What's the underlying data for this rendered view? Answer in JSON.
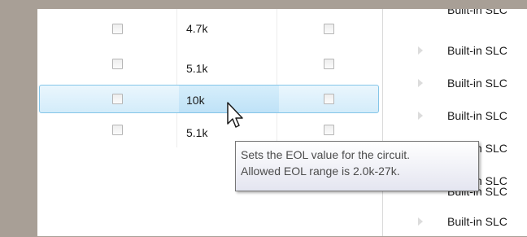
{
  "grid": {
    "rows": [
      {
        "enabled_checked": false,
        "eol": "4.7k",
        "alarm_checked": false,
        "selected": false
      },
      {
        "enabled_checked": false,
        "eol": "5.1k",
        "alarm_checked": false,
        "selected": false
      },
      {
        "enabled_checked": false,
        "eol": "10k",
        "alarm_checked": false,
        "selected": true
      },
      {
        "enabled_checked": false,
        "eol": "5.1k",
        "alarm_checked": false,
        "selected": false
      }
    ]
  },
  "tree": {
    "items": [
      {
        "label": "Built-in SLC"
      },
      {
        "label": "Built-in SLC"
      },
      {
        "label": "Built-in SLC"
      },
      {
        "label": "Built-in SLC"
      },
      {
        "label": "Built-in SLC"
      },
      {
        "label": "Built-in SLC"
      },
      {
        "label": "Built-in SLC"
      },
      {
        "label": "Built-in SLC"
      }
    ]
  },
  "tooltip": {
    "line1": "Sets the EOL value for the circuit.",
    "line2": "Allowed EOL range is 2.0k-27k."
  },
  "icons": {
    "cursor": "arrow-pointer-icon",
    "expander": "tree-expand-arrow-icon"
  },
  "colors": {
    "selection_border": "#84c5e8",
    "selection_fill": "#d3ecfa",
    "backdrop": "#a89f96"
  }
}
